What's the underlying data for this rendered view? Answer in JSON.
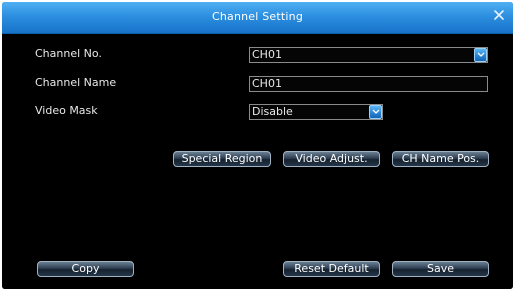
{
  "window": {
    "title": "Channel Setting",
    "close_icon": "close-icon",
    "accent": "#2d8fe0"
  },
  "form": {
    "channel_no": {
      "label": "Channel No.",
      "value": "CH01"
    },
    "channel_name": {
      "label": "Channel Name",
      "value": "CH01"
    },
    "video_mask": {
      "label": "Video Mask",
      "value": "Disable"
    }
  },
  "buttons": {
    "special_region": "Special Region",
    "video_adjust": "Video Adjust.",
    "ch_name_pos": "CH Name Pos.",
    "copy": "Copy",
    "reset_default": "Reset Default",
    "save": "Save"
  }
}
